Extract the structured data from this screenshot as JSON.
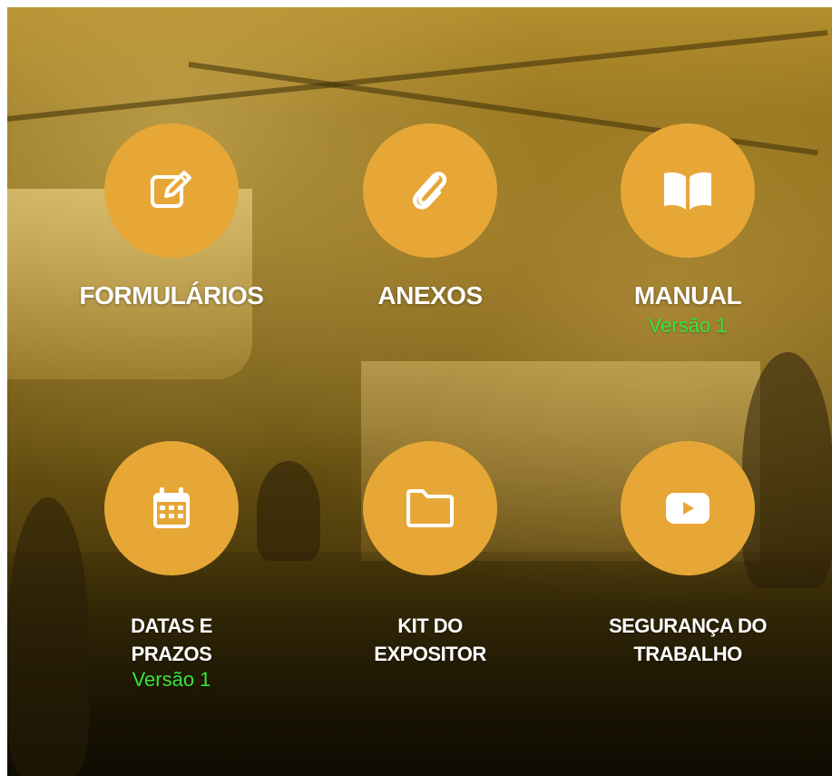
{
  "colors": {
    "circle": "#e7a736",
    "label": "#ffffff",
    "version": "#38e43a"
  },
  "items": [
    {
      "label": "FORMULÁRIOS",
      "icon": "edit-icon",
      "version": ""
    },
    {
      "label": "ANEXOS",
      "icon": "paperclip-icon",
      "version": ""
    },
    {
      "label": "MANUAL",
      "icon": "book-icon",
      "version": "Versão 1"
    },
    {
      "label_line1": "DATAS E",
      "label_line2": "PRAZOS",
      "icon": "calendar-icon",
      "version": "Versão 1"
    },
    {
      "label_line1": "KIT DO",
      "label_line2": "EXPOSITOR",
      "icon": "folder-icon",
      "version": ""
    },
    {
      "label_line1": "SEGURANÇA DO",
      "label_line2": "TRABALHO",
      "icon": "youtube-play-icon",
      "version": ""
    }
  ]
}
